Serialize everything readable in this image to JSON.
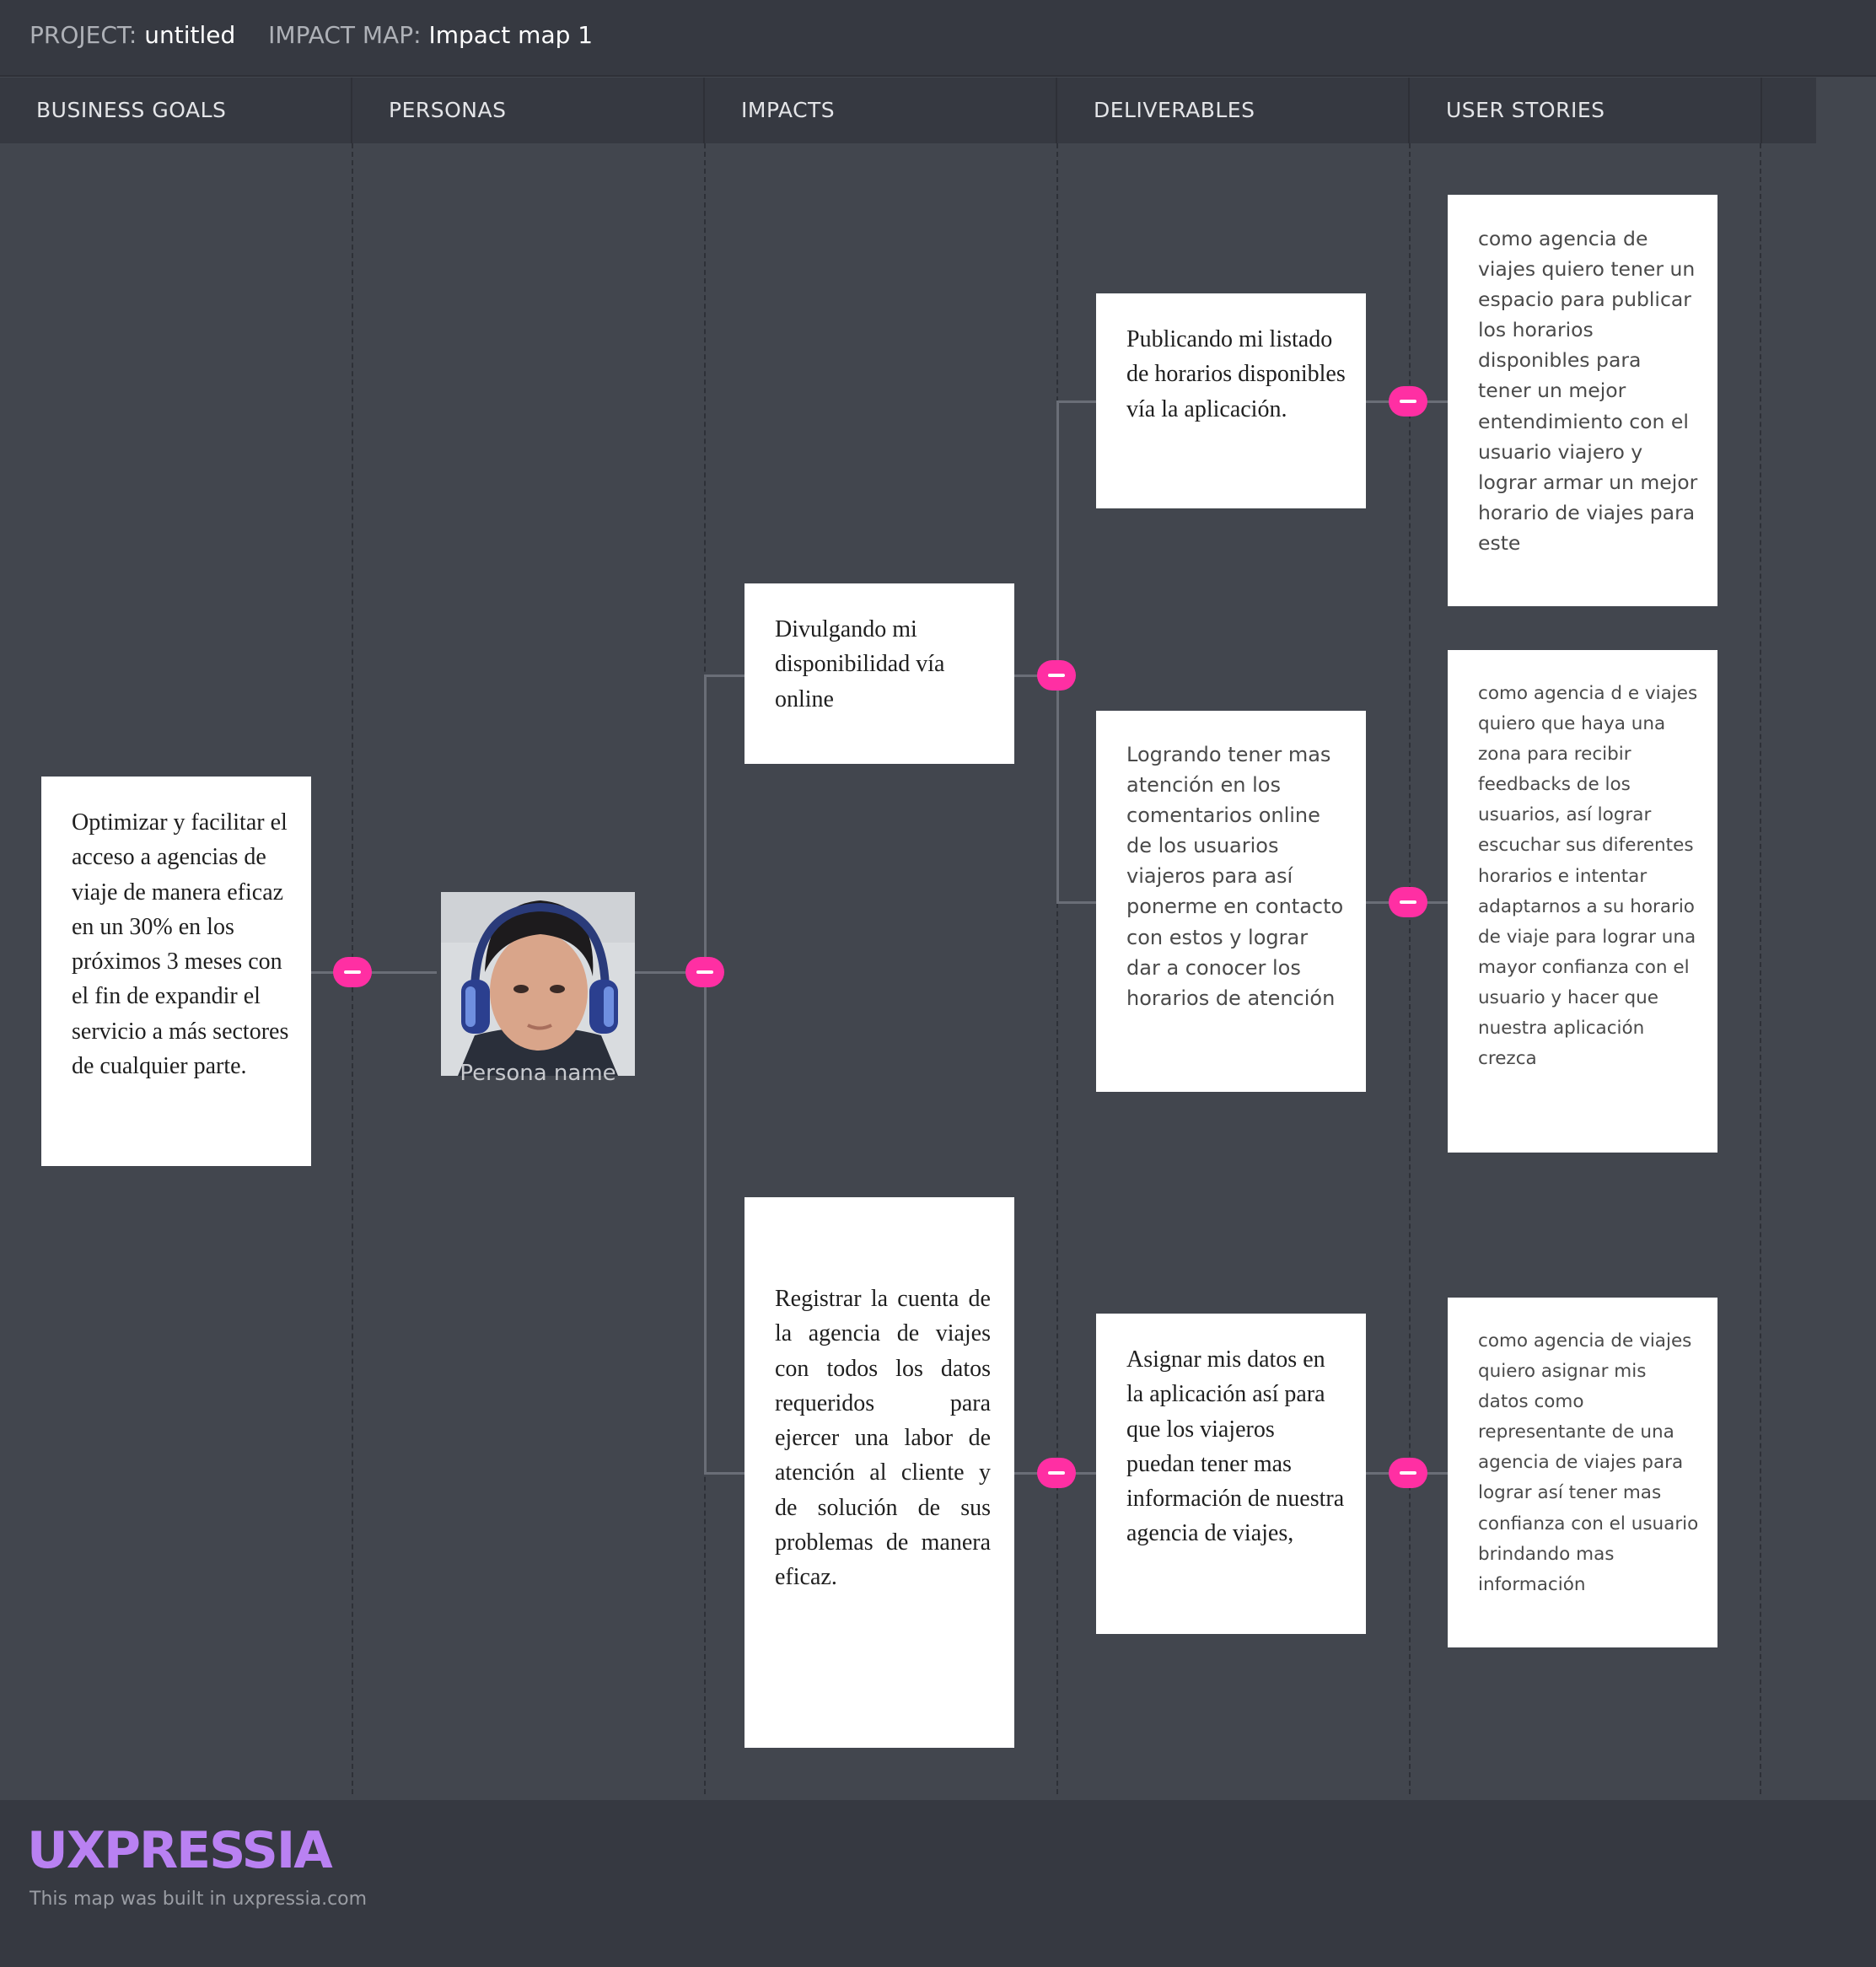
{
  "header": {
    "project_label": "PROJECT:",
    "project_value": "untitled",
    "map_label": "IMPACT MAP:",
    "map_value": "Impact map 1"
  },
  "columns": [
    "BUSINESS GOALS",
    "PERSONAS",
    "IMPACTS",
    "DELIVERABLES",
    "USER STORIES"
  ],
  "business_goal": "Optimizar y facilitar el acceso a agencias de viaje  de manera eficaz en un 30% en los próximos 3 meses con el fin de expandir el servicio a más sectores de cualquier parte.",
  "persona": {
    "name": "Persona name",
    "avatar_icon": "user-photo-icon"
  },
  "impacts": [
    "Divulgando mi disponibilidad vía online",
    "Registrar la cuenta de la agencia de viajes  con todos los datos requeridos para ejercer una labor de atención al cliente y de solución de sus problemas de manera eficaz."
  ],
  "deliverables": [
    "Publicando mi listado de horarios disponibles vía la aplicación.",
    "Logrando tener mas atención en los comentarios online  de los usuarios viajeros para así ponerme en contacto con estos y lograr dar a conocer los horarios de  atención",
    "Asignar mis datos en la aplicación así para que los viajeros puedan tener mas información de nuestra agencia de viajes,"
  ],
  "user_stories": [
    "como agencia de  viajes quiero tener un espacio para publicar los horarios disponibles para tener un mejor entendimiento con el usuario viajero y lograr armar  un mejor horario de viajes para este",
    "como agencia d e viajes quiero que haya una zona para recibir feedbacks de los usuarios, así lograr escuchar sus diferentes horarios e intentar adaptarnos a su horario de viaje para lograr una mayor confianza con el usuario y hacer que nuestra aplicación crezca",
    "como agencia de viajes quiero asignar mis datos como representante de una agencia de viajes para lograr así tener mas confianza con el usuario brindando mas información"
  ],
  "footer": {
    "logo": "UXPRESSIA",
    "tagline": "This map was built in uxpressia.com"
  },
  "colors": {
    "background": "#42464e",
    "header_bg": "#363941",
    "node_accent": "#ff2fa3",
    "logo": "#b981f2",
    "card": "#ffffff"
  }
}
